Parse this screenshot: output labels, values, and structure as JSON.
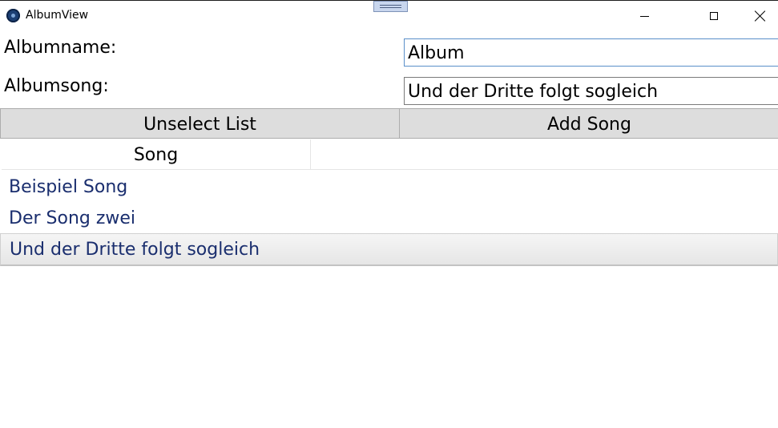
{
  "window": {
    "title": "AlbumView"
  },
  "form": {
    "albumname_label": "Albumname:",
    "albumname_value": "Album",
    "albumsong_label": "Albumsong:",
    "albumsong_value": "Und der Dritte folgt sogleich"
  },
  "buttons": {
    "unselect_label": "Unselect List",
    "add_song_label": "Add Song"
  },
  "list": {
    "column_header": "Song",
    "items": [
      "Beispiel Song",
      "Der Song zwei",
      "Und der Dritte folgt sogleich"
    ],
    "selected_index": 2
  },
  "icons": {
    "app": "album-app-icon",
    "minimize": "minimize-icon",
    "maximize": "maximize-icon",
    "close": "close-icon",
    "drag": "drag-handle-icon"
  },
  "colors": {
    "list_text": "#1a2e6e",
    "button_bg": "#dddddd",
    "focus_border": "#5a8fc9",
    "selected_row": "#e6e6e6"
  }
}
